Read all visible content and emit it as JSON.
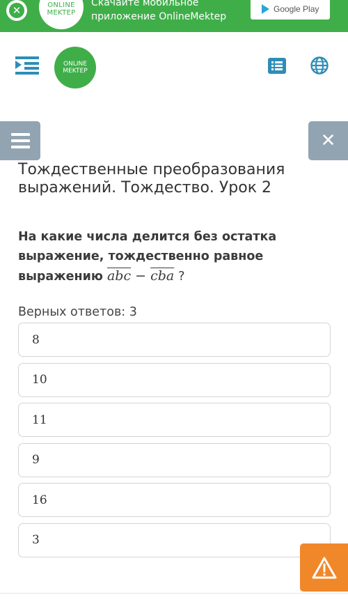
{
  "banner": {
    "close_icon": "close-circle-icon",
    "logo_line1": "ONLINE",
    "logo_line2": "MEKTEP",
    "text_line1": "Скачайте мобильное",
    "text_line2": "приложение OnlineMektep",
    "store_label": "Google Play",
    "color": "#3fae49"
  },
  "header": {
    "logo_line1": "ONLINE",
    "logo_line2": "MEKTEP",
    "menu_icon": "menu-collapse-icon",
    "list_icon": "list-icon",
    "language_icon": "globe-icon",
    "accent": "#2e8db8"
  },
  "toolbar": {
    "menu_icon": "hamburger-icon",
    "close_icon": "close-icon",
    "close_glyph": "✕",
    "button_color": "#92a4b1"
  },
  "lesson": {
    "title": "Тождественные преобразования выражений. Тождество. Урок 2"
  },
  "question": {
    "text": "На какие числа делится без остатка выражение, тождественно равное выражению",
    "expr_a": "abc",
    "minus": " − ",
    "expr_b": "cba",
    "tail": " ?"
  },
  "answers": {
    "count_label": "Верных ответов: 3",
    "options": [
      "8",
      "10",
      "11",
      "9",
      "16",
      "3"
    ]
  },
  "report": {
    "icon": "warning-icon",
    "color": "#f0882a"
  }
}
